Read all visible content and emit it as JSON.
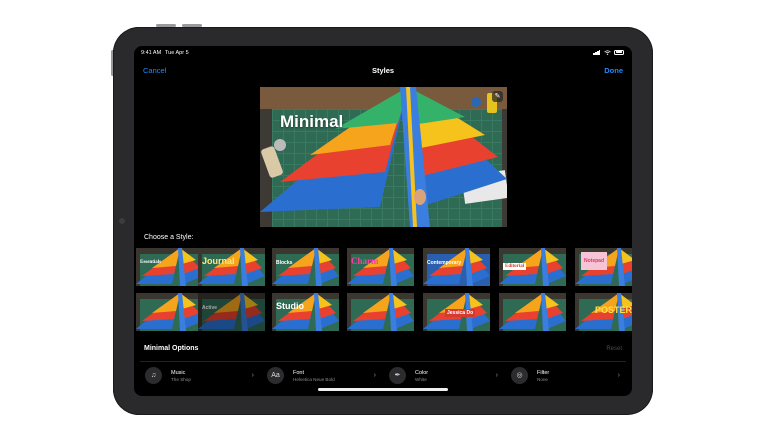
{
  "status_bar": {
    "time": "9:41 AM",
    "date": "Tue Apr 5"
  },
  "nav": {
    "cancel_label": "Cancel",
    "title": "Styles",
    "done_label": "Done"
  },
  "preview": {
    "style_name": "Minimal"
  },
  "choose_label": "Choose a Style:",
  "styles_row1": [
    {
      "label": "Essentials",
      "color": "#ffffff"
    },
    {
      "label": "Journal",
      "color": "#ffe97a"
    },
    {
      "label": "Blocks",
      "color": "#ffffff"
    },
    {
      "label": "Charm",
      "color": "#ff3fa6"
    },
    {
      "label": "Contemporary",
      "color": "#ffffff"
    },
    {
      "label": "Editorial",
      "color": "#d43b2e"
    },
    {
      "label": "Notepad",
      "color": "#d43b6a"
    }
  ],
  "styles_row2": [
    {
      "label": "",
      "color": "#ffffff"
    },
    {
      "label": "Active",
      "color": "#ffffff"
    },
    {
      "label": "Studio",
      "color": "#ffffff"
    },
    {
      "label": "",
      "color": "#ffffff"
    },
    {
      "label": "Jessica Do",
      "color": "#ffffff"
    },
    {
      "label": "",
      "color": "#ffffff"
    },
    {
      "label": "POSTER",
      "color": "#ffe14a"
    }
  ],
  "options": {
    "title": "Minimal Options",
    "reset_label": "Reset",
    "items": [
      {
        "name": "Music",
        "value": "The Shop",
        "icon": "music-note-icon"
      },
      {
        "name": "Font",
        "value": "Helvetica Neue Bold",
        "icon": "font-icon"
      },
      {
        "name": "Color",
        "value": "White",
        "icon": "eyedropper-icon"
      },
      {
        "name": "Filter",
        "value": "None",
        "icon": "filter-icon"
      }
    ]
  },
  "accent_color": "#1f8bff"
}
